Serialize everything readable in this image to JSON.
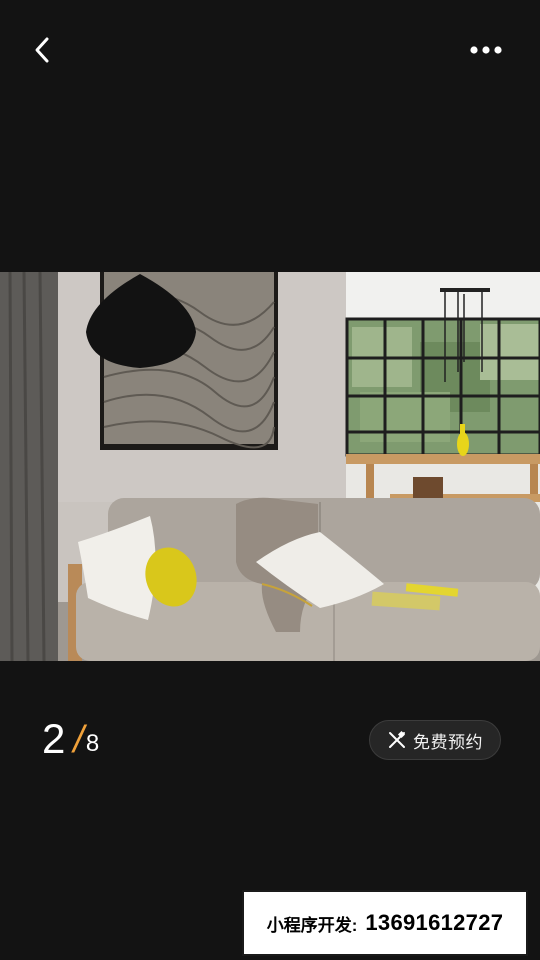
{
  "header": {
    "back_icon": "chevron-left-icon",
    "more_icon": "more-dots-icon"
  },
  "gallery": {
    "current": "2",
    "separator": "/",
    "total": "8",
    "accent_color": "#f0a13a"
  },
  "booking": {
    "icon": "pencil-ruler-icon",
    "label": "免费预约"
  },
  "banner": {
    "label": "小程序开发:",
    "phone": "13691612727"
  },
  "colors": {
    "background": "#131313",
    "button_background": "#262626",
    "banner_background": "#ffffff"
  }
}
